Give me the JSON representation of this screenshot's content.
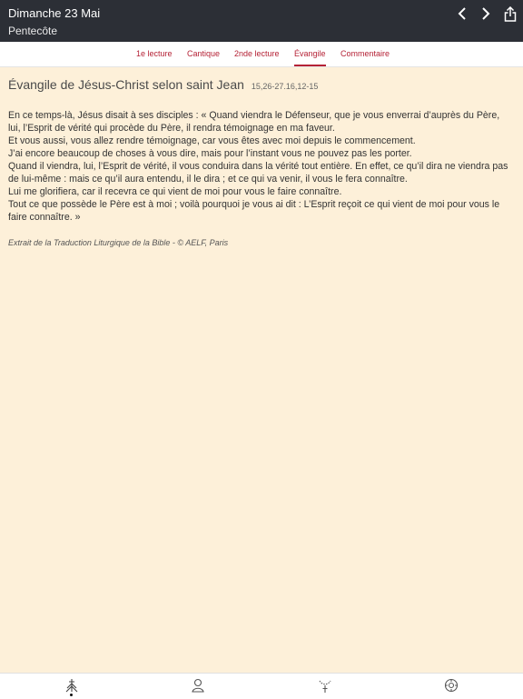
{
  "header": {
    "date": "Dimanche 23 Mai",
    "feast": "Pentecôte",
    "prev_icon": "chevron-left-icon",
    "next_icon": "chevron-right-icon",
    "share_icon": "share-icon"
  },
  "tabs": [
    {
      "label": "1e lecture",
      "active": false
    },
    {
      "label": "Cantique",
      "active": false
    },
    {
      "label": "2nde lecture",
      "active": false
    },
    {
      "label": "Évangile",
      "active": true
    },
    {
      "label": "Commentaire",
      "active": false
    }
  ],
  "reading": {
    "title": "Évangile de Jésus-Christ selon saint Jean",
    "reference": "15,26-27.16,12-15",
    "paragraphs": [
      "En ce temps-là, Jésus disait à ses disciples : « Quand viendra le Défenseur, que je vous enverrai d’auprès du Père, lui, l’Esprit de vérité qui procède du Père, il rendra témoignage en ma faveur.",
      "Et vous aussi, vous allez rendre témoignage, car vous êtes avec moi depuis le commencement.",
      "J’ai encore beaucoup de choses à vous dire, mais pour l’instant vous ne pouvez pas les porter.",
      "Quand il viendra, lui, l’Esprit de vérité, il vous conduira dans la vérité tout entière. En effet, ce qu’il dira ne viendra pas de lui-même : mais ce qu’il aura entendu, il le dira ; et ce qui va venir, il vous le fera connaître.",
      "Lui me glorifiera, car il recevra ce qui vient de moi pour vous le faire connaître.",
      "Tout ce que possède le Père est à moi ; voilà pourquoi je vous ai dit : L’Esprit reçoit ce qui vient de moi pour vous le faire connaître. »"
    ],
    "credit": "Extrait de la Traduction Liturgique de la Bible - © AELF, Paris"
  },
  "bottom_nav": [
    {
      "icon": "readings-icon",
      "active": true
    },
    {
      "icon": "prayer-person-icon",
      "active": false
    },
    {
      "icon": "rosary-icon",
      "active": false
    },
    {
      "icon": "settings-icon",
      "active": false
    }
  ],
  "colors": {
    "accent": "#b52236",
    "header_bg": "#2c2f36",
    "page_bg": "#fdf0d9"
  }
}
